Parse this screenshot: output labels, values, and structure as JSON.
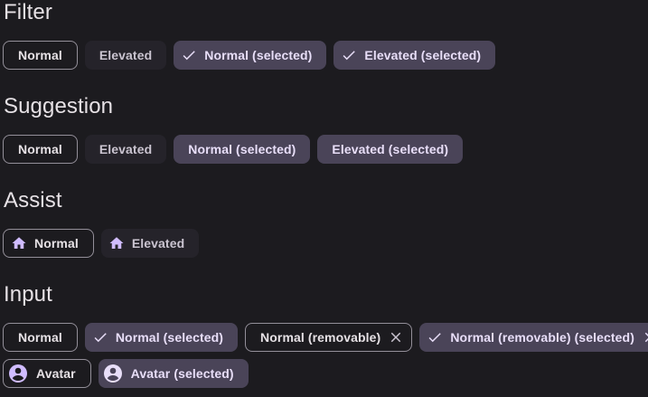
{
  "colors": {
    "background": "#1c1b1f",
    "outline": "#938f99",
    "elevated": "#25232a",
    "selected": "#4a4458",
    "primary_icon": "#d0bcff",
    "on_surface": "#e6e1e5"
  },
  "filter": {
    "title": "Filter",
    "chips": [
      "Normal",
      "Elevated",
      "Normal (selected)",
      "Elevated (selected)"
    ],
    "check_icon": "check-icon"
  },
  "suggestion": {
    "title": "Suggestion",
    "chips": [
      "Normal",
      "Elevated",
      "Normal (selected)",
      "Elevated (selected)"
    ]
  },
  "assist": {
    "title": "Assist",
    "chips": [
      "Normal",
      "Elevated"
    ],
    "leading_icon": "home-icon"
  },
  "input": {
    "title": "Input",
    "chips": [
      "Normal",
      "Normal (selected)",
      "Normal (removable)",
      "Normal (removable) (selected)"
    ],
    "avatar_chips": [
      "Avatar",
      "Avatar (selected)"
    ],
    "remove_icon": "close-icon",
    "avatar_icon": "account-circle-icon"
  }
}
